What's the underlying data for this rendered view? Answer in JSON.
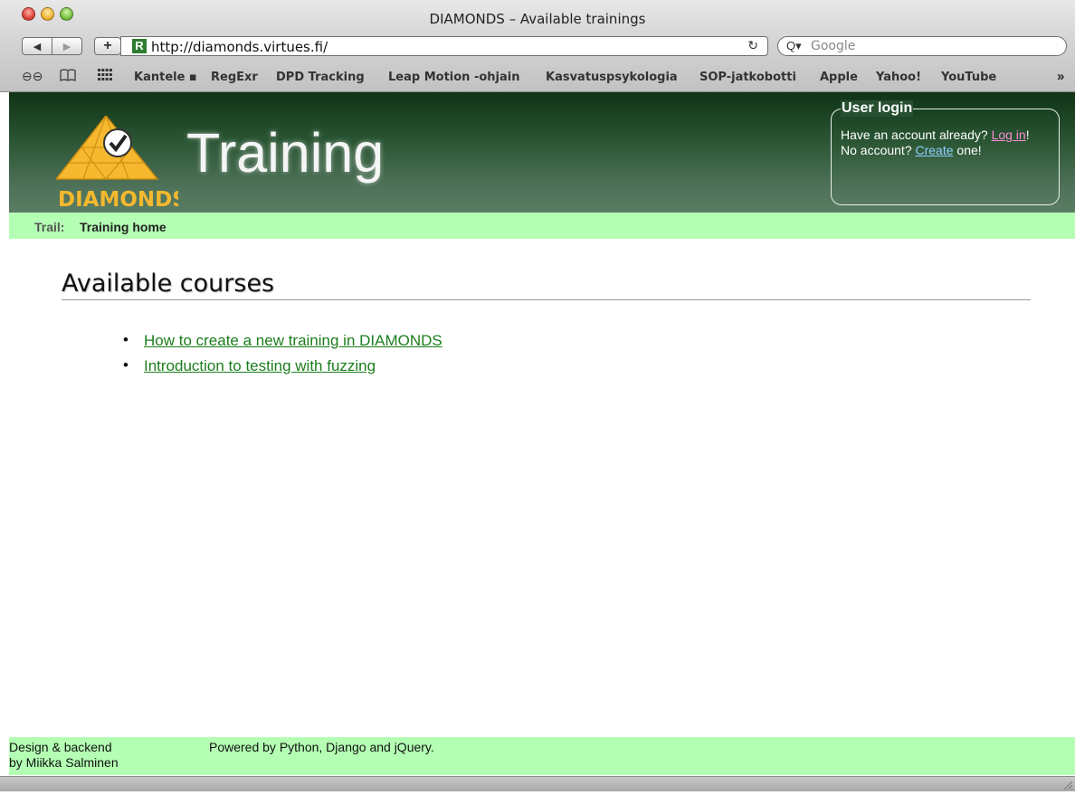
{
  "window": {
    "title": "DIAMONDS – Available trainings"
  },
  "toolbar": {
    "back_label": "◀",
    "forward_label": "▶",
    "add_label": "+",
    "site_icon_letter": "R",
    "url": "http://diamonds.virtues.fi/",
    "reload_icon": "↻",
    "search_placeholder": "Google",
    "search_icon": "Q▾"
  },
  "bookmarks": {
    "reader_icon": "⊖⊖",
    "book_icon": "📖",
    "grid_icon": "⋮⋮⋮",
    "items": [
      "Kantele ▪",
      "RegExr",
      "DPD Tracking",
      "Leap Motion -ohjain",
      "Kasvatuspsykologia",
      "SOP-jatkobotti",
      "Apple",
      "Yahoo!",
      "YouTube"
    ],
    "more": "»"
  },
  "header": {
    "title": "Training",
    "logo_text": "DIAMONDS"
  },
  "login": {
    "title": "User login",
    "line1_prefix": "Have an account already? ",
    "login_link": "Log in",
    "line1_suffix": "!",
    "line2_prefix": "No account? ",
    "create_link": "Create",
    "line2_suffix": " one!"
  },
  "trail": {
    "label": "Trail:",
    "item": "Training home"
  },
  "main": {
    "heading": "Available courses",
    "courses": [
      "How to create a new training in DIAMONDS",
      "Introduction to testing with fuzzing"
    ]
  },
  "footer": {
    "credit_line1": "Design & backend",
    "credit_line2": "by Miikka Salminen",
    "powered": "Powered by Python, Django and jQuery."
  },
  "colors": {
    "header_dark": "#0f3316",
    "header_light": "#5a7c62",
    "trail_bg": "#b4ffb4",
    "link_green": "#1c7d1c",
    "login_link": "#ff8ad8",
    "create_link": "#8fd1ff",
    "logo_gold": "#f5b82e"
  }
}
